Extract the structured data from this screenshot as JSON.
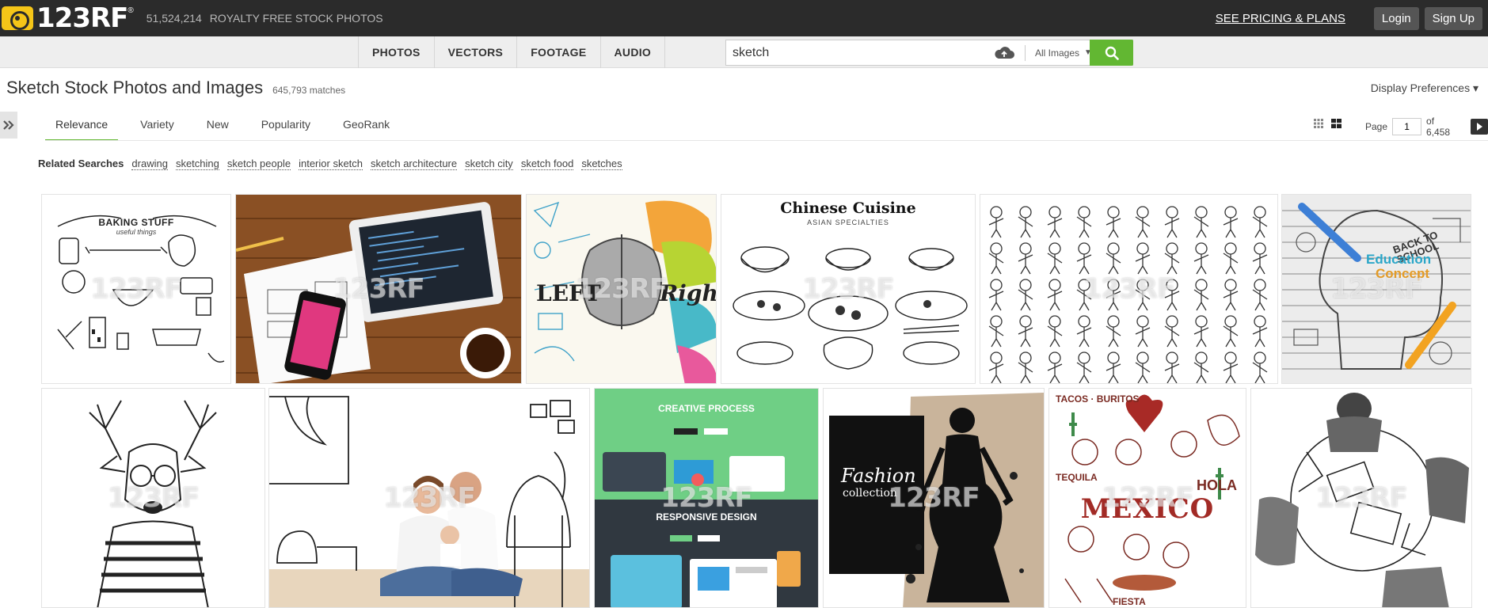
{
  "header": {
    "logo_text": "123RF",
    "logo_reg": "®",
    "photo_count": "51,524,214",
    "tagline": "ROYALTY FREE STOCK PHOTOS",
    "pricing_link": "SEE PRICING & PLANS",
    "login": "Login",
    "signup": "Sign Up"
  },
  "nav": {
    "tabs": [
      "PHOTOS",
      "VECTORS",
      "FOOTAGE",
      "AUDIO"
    ]
  },
  "search": {
    "value": "sketch",
    "filter": "All Images",
    "filter_caret": "▼"
  },
  "results": {
    "title": "Sketch Stock Photos and Images",
    "matches": "645,793 matches",
    "display_preferences": "Display Preferences ▾"
  },
  "sort": {
    "tabs": [
      "Relevance",
      "Variety",
      "New",
      "Popularity",
      "GeoRank"
    ],
    "active": "Relevance"
  },
  "pager": {
    "label": "Page",
    "current": "1",
    "of_label": "of 6,458"
  },
  "related": {
    "label": "Related Searches",
    "items": [
      "drawing",
      "sketching",
      "sketch people",
      "interior sketch",
      "sketch architecture",
      "sketch city",
      "sketch food",
      "sketches"
    ]
  },
  "watermark": "123RF",
  "tiles": {
    "baking": {
      "title": "BAKING STUFF",
      "subtitle": "useful things"
    },
    "brain": {
      "left": "LEFT",
      "right": "Right"
    },
    "chinese": {
      "title": "Chinese Cuisine",
      "subtitle": "ASIAN SPECIALTIES"
    },
    "education": {
      "line1": "Education",
      "line2": "Concept",
      "back": "BACK TO SCHOOL"
    },
    "creative": {
      "top": "CREATIVE PROCESS",
      "bottom": "RESPONSIVE DESIGN"
    },
    "fashion": {
      "line1": "Fashion",
      "line2": "collection"
    },
    "mexico": {
      "word": "MEXICO",
      "tacos": "TACOS · BURITOS",
      "tequila": "TEQUILA",
      "hola": "HOLA",
      "fiesta": "FIESTA"
    }
  },
  "colors": {
    "topbar": "#2b2b2b",
    "accent_green": "#62b732",
    "logo_yellow": "#f5c518"
  }
}
